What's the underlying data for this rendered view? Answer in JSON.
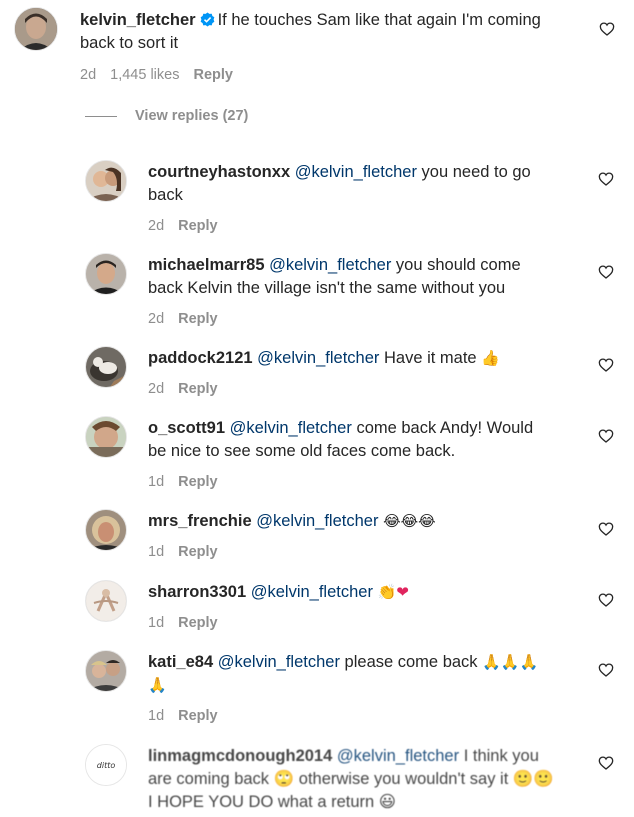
{
  "main_comment": {
    "username": "kelvin_fletcher",
    "text_line1": "If he touches Sam like that again I'm coming",
    "text_line2": "back to sort it",
    "time": "2d",
    "likes": "1,445 likes",
    "reply": "Reply"
  },
  "view_replies": "View replies (27)",
  "replies": [
    {
      "username": "courtneyhastonxx",
      "mention": "@kelvin_fletcher",
      "text": " you need to go",
      "text2": "back",
      "time": "2d",
      "reply": "Reply"
    },
    {
      "username": "michaelmarr85",
      "mention": "@kelvin_fletcher",
      "text": " you should come",
      "text2": "back Kelvin the village isn't the same without you",
      "time": "2d",
      "reply": "Reply"
    },
    {
      "username": "paddock2121",
      "mention": "@kelvin_fletcher",
      "text": " Have it mate ",
      "emoji": "👍",
      "time": "2d",
      "reply": "Reply"
    },
    {
      "username": "o_scott91",
      "mention": "@kelvin_fletcher",
      "text": " come back Andy! Would",
      "text2": "be nice to see some old faces come back.",
      "time": "1d",
      "reply": "Reply"
    },
    {
      "username": "mrs_frenchie",
      "mention": "@kelvin_fletcher",
      "text": " ",
      "emoji": "😂😂😂",
      "time": "1d",
      "reply": "Reply"
    },
    {
      "username": "sharron3301",
      "mention": "@kelvin_fletcher",
      "text": " ",
      "emoji": "👏❤",
      "time": "1d",
      "reply": "Reply"
    },
    {
      "username": "kati_e84",
      "mention": "@kelvin_fletcher",
      "text": " please come back ",
      "emoji": "🙏🙏🙏",
      "text2": "🙏",
      "time": "1d",
      "reply": "Reply"
    },
    {
      "username": "linmagmcdonough2014",
      "mention": "@kelvin_fletcher",
      "text": " I think you",
      "text2": "are coming back 🙄 otherwise you wouldn't say it 🙂🙂",
      "text3": "I HOPE YOU DO what a return 😃",
      "avatar_text": "ditto"
    }
  ],
  "icons": {
    "heart": "heart-icon",
    "verified": "verified-badge-icon"
  },
  "colors": {
    "mention": "#00376b",
    "meta": "#8e8e8e",
    "verified": "#0095f6"
  }
}
